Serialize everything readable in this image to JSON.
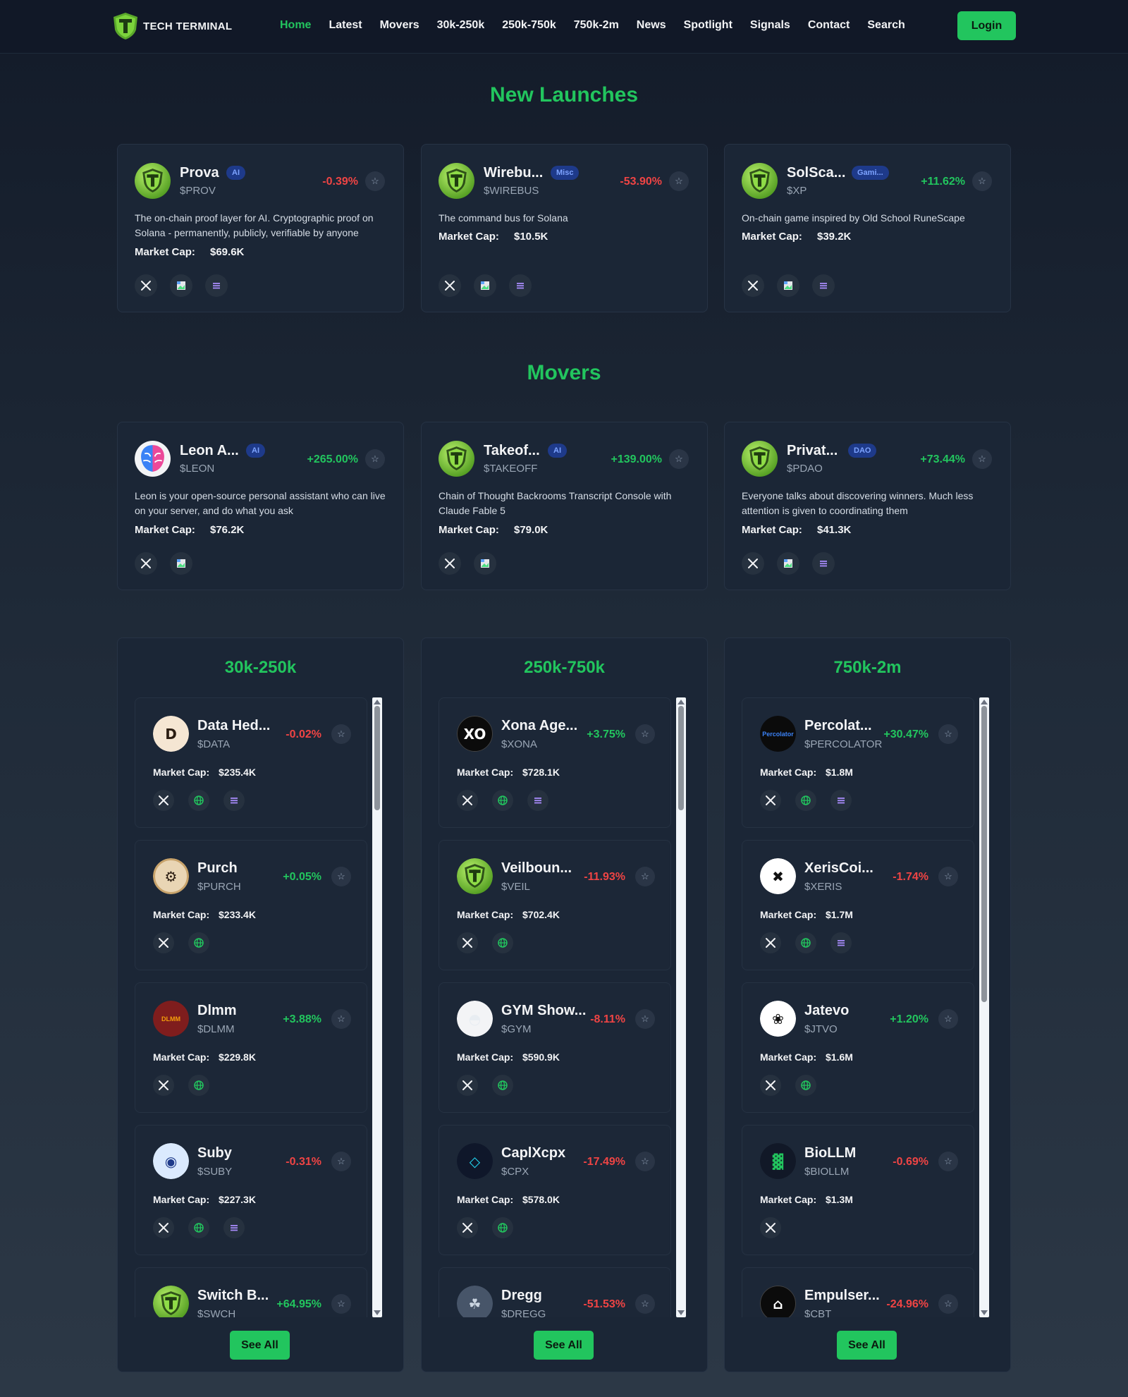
{
  "brand": {
    "name": "TECH TERMINAL",
    "accent": "#22c55e",
    "logo_icon": "shield-t-logo"
  },
  "nav": {
    "links": [
      "Home",
      "Latest",
      "Movers",
      "30k-250k",
      "250k-750k",
      "750k-2m",
      "News",
      "Spotlight",
      "Signals",
      "Contact",
      "Search"
    ],
    "active": "Home",
    "login_label": "Login"
  },
  "new_launches": {
    "title": "New Launches",
    "cards": [
      {
        "name": "Prova",
        "tag": "AI",
        "symbol": "$PROV",
        "change": "-0.39%",
        "desc": "The on-chain proof layer for AI. Cryptographic proof on Solana - permanently, publicly, verifiable by anyone",
        "market_cap_label": "Market Cap:",
        "market_cap": "$69.6K"
      },
      {
        "name": "Wirebu...",
        "tag": "Misc",
        "symbol": "$WIREBUS",
        "change": "-53.90%",
        "desc": "The command bus for Solana",
        "market_cap_label": "Market Cap:",
        "market_cap": "$10.5K"
      },
      {
        "name": "SolSca...",
        "tag": "Gami...",
        "symbol": "$XP",
        "change": "+11.62%",
        "desc": "On-chain game inspired by Old School RuneScape",
        "market_cap_label": "Market Cap:",
        "market_cap": "$39.2K"
      }
    ]
  },
  "movers": {
    "title": "Movers",
    "cards": [
      {
        "name": "Leon A...",
        "tag": "AI",
        "symbol": "$LEON",
        "change": "+265.00%",
        "desc": "Leon is your open-source personal assistant who can live on your server, and do what you ask",
        "market_cap_label": "Market Cap:",
        "market_cap": "$76.2K"
      },
      {
        "name": "Takeof...",
        "tag": "AI",
        "symbol": "$TAKEOFF",
        "change": "+139.00%",
        "desc": "Chain of Thought Backrooms Transcript Console with Claude Fable 5",
        "market_cap_label": "Market Cap:",
        "market_cap": "$79.0K"
      },
      {
        "name": "Privat...",
        "tag": "DAO",
        "symbol": "$PDAO",
        "change": "+73.44%",
        "desc": "Everyone talks about discovering winners. Much less attention is given to coordinating them",
        "market_cap_label": "Market Cap:",
        "market_cap": "$41.3K"
      }
    ]
  },
  "columns": [
    {
      "title": "30k-250k",
      "see_all": "See All",
      "items": [
        {
          "name": "Data Hed...",
          "symbol": "$DATA",
          "change": "-0.02%",
          "market_cap_label": "Market Cap:",
          "market_cap": "$235.4K"
        },
        {
          "name": "Purch",
          "symbol": "$PURCH",
          "change": "+0.05%",
          "market_cap_label": "Market Cap:",
          "market_cap": "$233.4K"
        },
        {
          "name": "Dlmm",
          "symbol": "$DLMM",
          "change": "+3.88%",
          "market_cap_label": "Market Cap:",
          "market_cap": "$229.8K",
          "logo_text": "DLMM"
        },
        {
          "name": "Suby",
          "symbol": "$SUBY",
          "change": "-0.31%",
          "market_cap_label": "Market Cap:",
          "market_cap": "$227.3K"
        },
        {
          "name": "Switch B...",
          "symbol": "$SWCH",
          "change": "+64.95%"
        }
      ]
    },
    {
      "title": "250k-750k",
      "see_all": "See All",
      "items": [
        {
          "name": "Xona Age...",
          "symbol": "$XONA",
          "change": "+3.75%",
          "market_cap_label": "Market Cap:",
          "market_cap": "$728.1K"
        },
        {
          "name": "Veilboun...",
          "symbol": "$VEIL",
          "change": "-11.93%",
          "market_cap_label": "Market Cap:",
          "market_cap": "$702.4K"
        },
        {
          "name": "GYM Show...",
          "symbol": "$GYM",
          "change": "-8.11%",
          "market_cap_label": "Market Cap:",
          "market_cap": "$590.9K"
        },
        {
          "name": "CaplXcpx",
          "symbol": "$CPX",
          "change": "-17.49%",
          "market_cap_label": "Market Cap:",
          "market_cap": "$578.0K"
        },
        {
          "name": "Dregg",
          "symbol": "$DREGG",
          "change": "-51.53%"
        }
      ]
    },
    {
      "title": "750k-2m",
      "see_all": "See All",
      "items": [
        {
          "name": "Percolat...",
          "symbol": "$PERCOLATOR",
          "change": "+30.47%",
          "market_cap_label": "Market Cap:",
          "market_cap": "$1.8M",
          "logo_text": "Percolator"
        },
        {
          "name": "XerisCoi...",
          "symbol": "$XERIS",
          "change": "-1.74%",
          "market_cap_label": "Market Cap:",
          "market_cap": "$1.7M"
        },
        {
          "name": "Jatevo",
          "symbol": "$JTVO",
          "change": "+1.20%",
          "market_cap_label": "Market Cap:",
          "market_cap": "$1.6M"
        },
        {
          "name": "BioLLM",
          "symbol": "$BIOLLM",
          "change": "-0.69%",
          "market_cap_label": "Market Cap:",
          "market_cap": "$1.3M"
        },
        {
          "name": "Empulser...",
          "symbol": "$CBT",
          "change": "-24.96%"
        }
      ]
    }
  ],
  "colors": {
    "positive": "#22c55e",
    "negative": "#ef4444",
    "card": "#1b2636",
    "tag_bg": "#1e3a8a",
    "tag_text": "#7da3ff"
  },
  "icons": [
    "x-icon",
    "broken-image-icon",
    "list-icon",
    "globe-icon",
    "star-icon"
  ]
}
